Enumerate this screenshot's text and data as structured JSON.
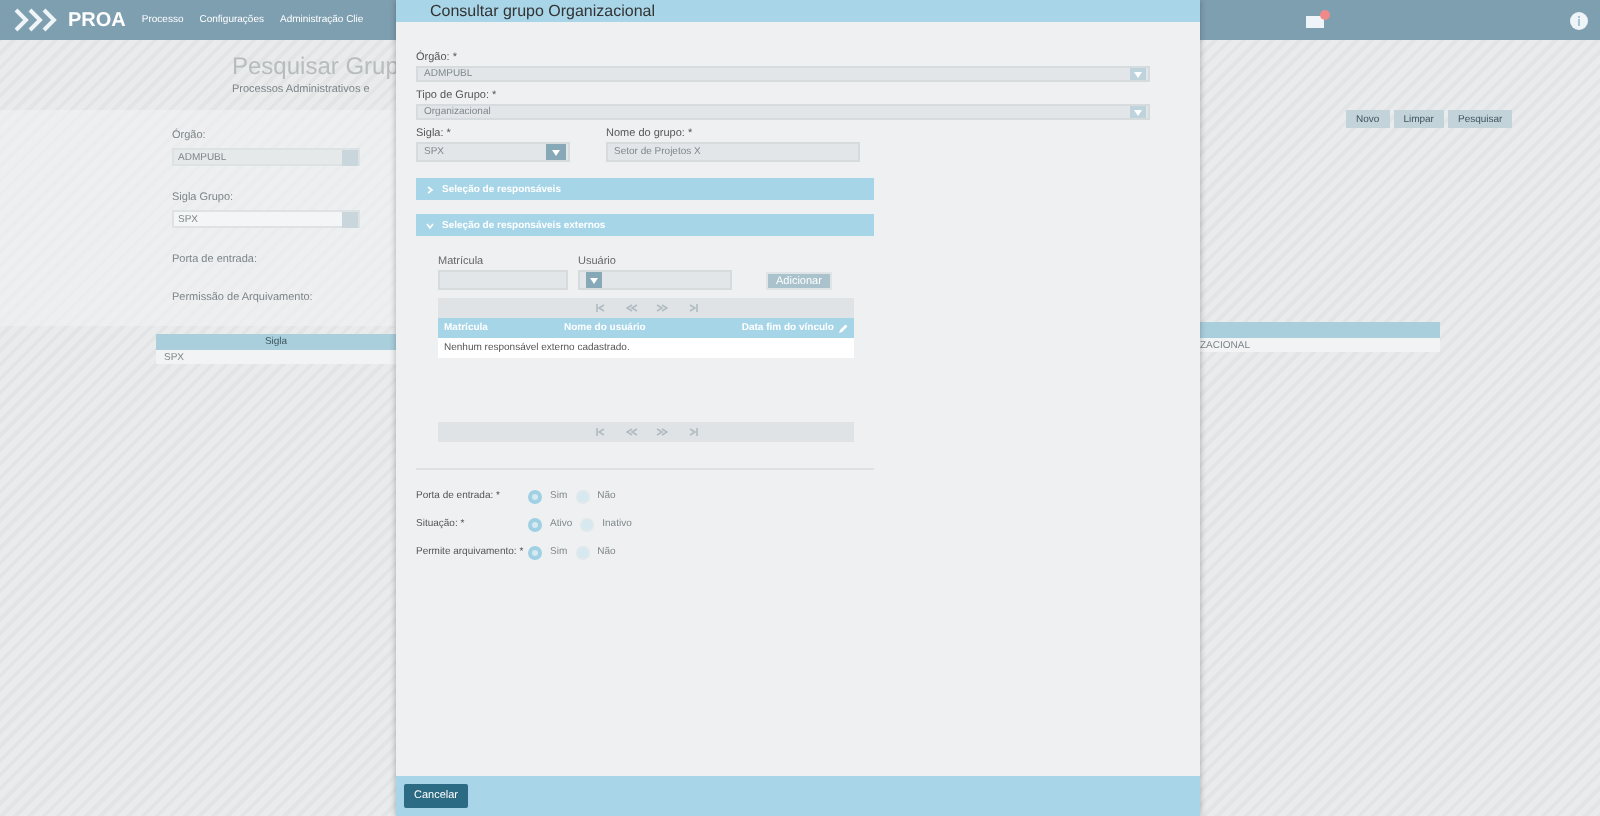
{
  "app_header": {
    "logo": "PROA",
    "menu": [
      "Processo",
      "Configurações",
      "Administração Clie"
    ],
    "has_notifications": true
  },
  "background_page": {
    "title": "Pesquisar Grup",
    "subtitle": "Processos Administrativos e",
    "filters": [
      {
        "label": "Órgão:",
        "value": "ADMPUBL",
        "kind": "disabled"
      },
      {
        "label": "Sigla Grupo:",
        "value": "SPX",
        "kind": "select"
      }
    ],
    "radio_labels": [
      "Porta de entrada:",
      "Permissão de Arquivamento:"
    ],
    "buttons": [
      "Novo",
      "Limpar",
      "Pesquisar"
    ],
    "table": {
      "column": "Sigla",
      "cell": "SPX",
      "right_cell": "ZACIONAL"
    }
  },
  "modal": {
    "title": "Consultar grupo Organizacional",
    "selects": [
      {
        "label": "Órgão: *",
        "value": "ADMPUBL"
      },
      {
        "label": "Tipo de Grupo: *",
        "value": "Organizacional"
      }
    ],
    "sigla": {
      "label": "Sigla: *",
      "value": "SPX"
    },
    "group_name": {
      "label": "Nome do grupo: *",
      "value": "Setor de Projetos X"
    },
    "sections": [
      {
        "title": "Seleção de responsáveis",
        "expanded": false
      },
      {
        "title": "Seleção de responsáveis externos",
        "expanded": true
      }
    ],
    "external": {
      "matricula_label": "Matrícula",
      "usuario_label": "Usuário",
      "add_button": "Adicionar",
      "columns": [
        "Matrícula",
        "Nome do usuário",
        "Data fim do vínculo"
      ],
      "empty_message": "Nenhum responsável externo cadastrado."
    },
    "radio_groups": [
      {
        "label": "Porta de entrada: *",
        "options": [
          {
            "label": "Sim",
            "selected": true
          },
          {
            "label": "Não",
            "selected": false
          }
        ]
      },
      {
        "label": "Situação: *",
        "options": [
          {
            "label": "Ativo",
            "selected": true
          },
          {
            "label": "Inativo",
            "selected": false
          }
        ]
      },
      {
        "label": "Permite arquivamento: *",
        "options": [
          {
            "label": "Sim",
            "selected": true
          },
          {
            "label": "Não",
            "selected": false
          }
        ]
      }
    ],
    "cancel_button": "Cancelar"
  }
}
